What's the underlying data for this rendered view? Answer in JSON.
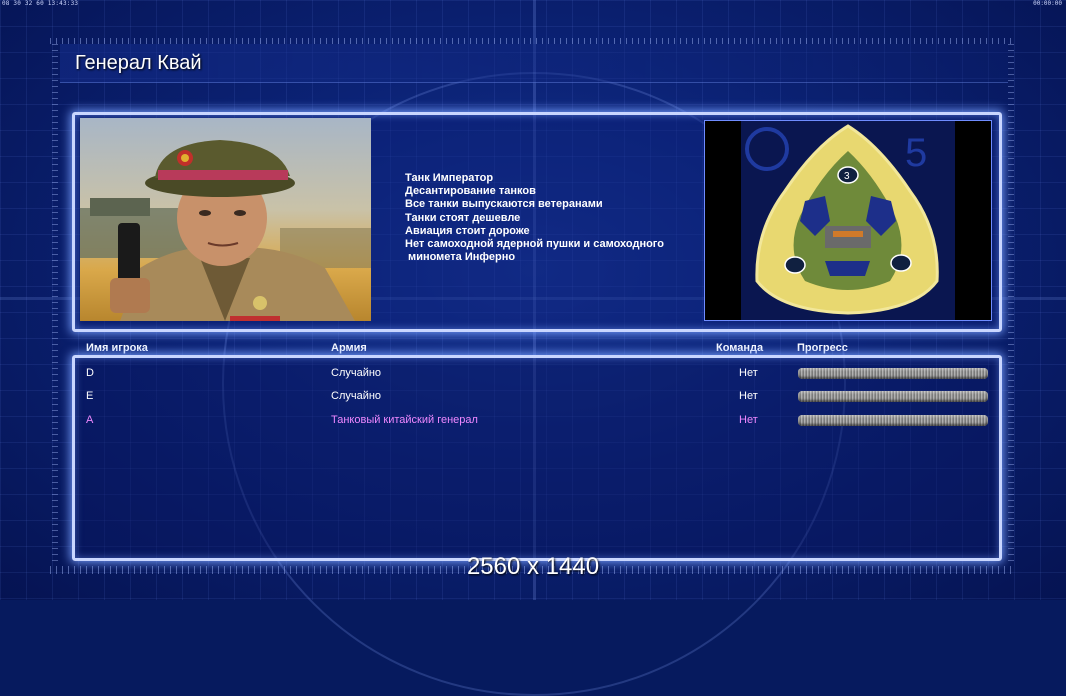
{
  "window": {
    "top_left_readout": "08 30 32 60 13:43:33",
    "top_right_readout": "00:00:00"
  },
  "header": {
    "title": "Генерал Квай"
  },
  "general": {
    "features": [
      "Танк Император",
      "Десантирование танков",
      "Все танки выпускаются ветеранами",
      "Танки стоят дешевле",
      "Авиация стоит дороже",
      "Нет самоходной ядерной пушки и самоходного",
      " миномета Инферно"
    ]
  },
  "minimap": {
    "marker_label": "3"
  },
  "players_table": {
    "columns": {
      "player_name": "Имя игрока",
      "army": "Армия",
      "team": "Команда",
      "progress": "Прогресс"
    },
    "rows": [
      {
        "name": "D",
        "army": "Случайно",
        "team": "Нет",
        "color": "#ffffff"
      },
      {
        "name": "E",
        "army": "Случайно",
        "team": "Нет",
        "color": "#ffffff"
      },
      {
        "name": "A",
        "army": "Танковый китайский генерал",
        "team": "Нет",
        "color": "#ee88ff"
      }
    ]
  },
  "overlay": {
    "resolution_label": "2560 x 1440"
  },
  "colors": {
    "background": "#061a5e",
    "panel_border": "#c9d6ff",
    "highlight_player": "#ee88ff"
  }
}
